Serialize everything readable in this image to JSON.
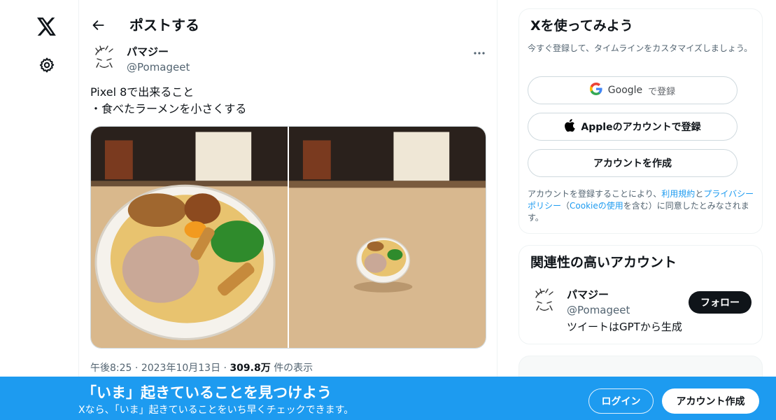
{
  "nav": {
    "logo_icon": "x-logo-icon",
    "settings_icon": "gear-icon"
  },
  "header": {
    "title": "ポストする",
    "back_icon": "arrow-left-icon"
  },
  "tweet": {
    "author_name": "パマジー",
    "author_handle": "@Pomageet",
    "text_lines": [
      "Pixel 8で出来ること",
      "・食べたラーメンを小さくする"
    ],
    "time": "午後8:25",
    "date": "2023年10月13日",
    "views_count": "309.8万",
    "views_label": "件の表示",
    "separator": "·"
  },
  "signup_card": {
    "title": "Xを使ってみよう",
    "subtitle": "今すぐ登録して、タイムラインをカスタマイズしましょう。",
    "google_brand": "Google",
    "google_suffix": "で登録",
    "apple_label": "Appleのアカウントで登録",
    "create_label": "アカウントを作成",
    "legal_prefix": "アカウントを登録することにより、",
    "legal_terms": "利用規約",
    "legal_and": "と",
    "legal_privacy": "プライバシーポリシー",
    "legal_paren_open": "（",
    "legal_cookie": "Cookieの使用",
    "legal_paren_rest": "を含む）に同意したとみなされます。"
  },
  "related_card": {
    "title": "関連性の高いアカウント",
    "name": "パマジー",
    "handle": "@Pomageet",
    "bio": "ツイートはGPTから生成",
    "follow_label": "フォロー"
  },
  "banner": {
    "title": "「いま」起きていることを見つけよう",
    "subtitle": "Xなら、「いま」起きていることをいち早くチェックできます。",
    "login_label": "ログイン",
    "signup_label": "アカウント作成"
  },
  "colors": {
    "accent": "#1d9bf0",
    "text": "#0f1419",
    "muted": "#536471",
    "border": "#eff3f4"
  }
}
